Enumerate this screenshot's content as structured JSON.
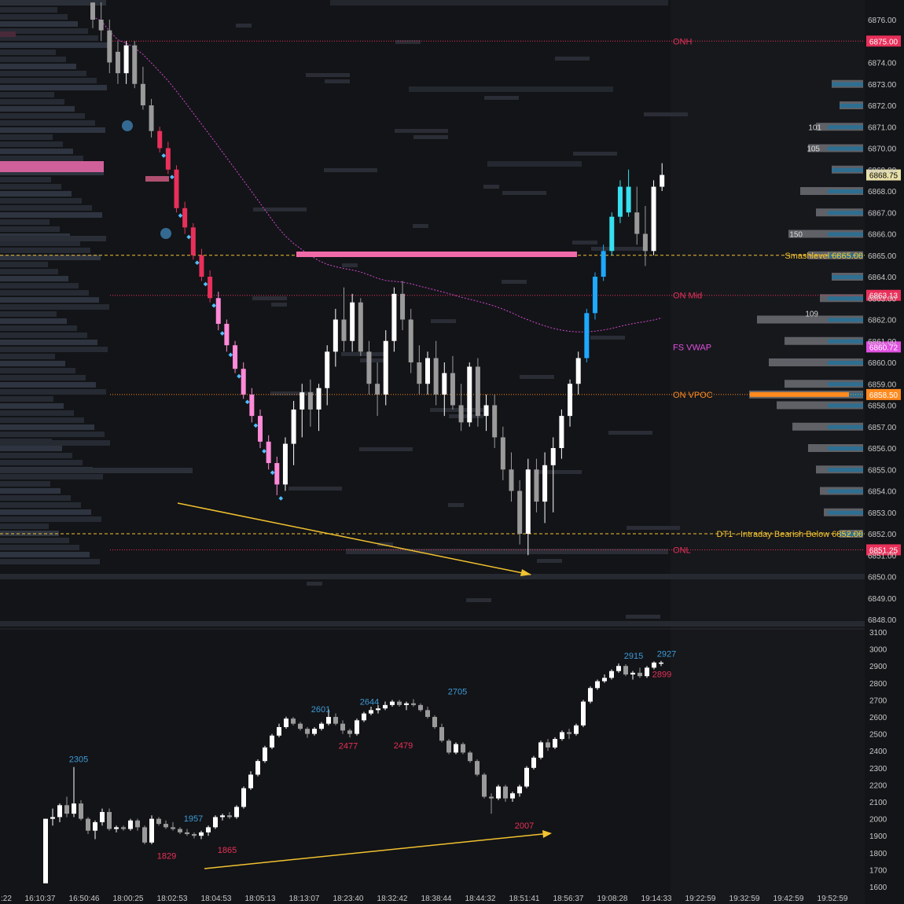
{
  "chart_data": [
    {
      "type": "candlestick",
      "panel": "price",
      "y_ticks": [
        6876,
        6874,
        6873,
        6872,
        6871,
        6870,
        6869,
        6868,
        6867,
        6866,
        6865,
        6864,
        6863,
        6862,
        6861,
        6860,
        6859,
        6858,
        6857,
        6856,
        6855,
        6854,
        6853,
        6852,
        6851,
        6850,
        6849,
        6848
      ],
      "ylim": [
        6847.5,
        6876.8
      ],
      "levels": [
        {
          "name": "ONH",
          "value": 6875.0,
          "label": "ONH",
          "price_tag": "6875.00",
          "color": "#e8305a",
          "style": "dotted"
        },
        {
          "name": "smashlevel",
          "value": 6865.0,
          "label": "Smashlevel  6865.00",
          "price_tag": "",
          "color": "#f2c230",
          "style": "dashed"
        },
        {
          "name": "ON Mid",
          "value": 6863.13,
          "label": "ON Mid",
          "price_tag": "6863.13",
          "color": "#e8305a",
          "style": "dotted"
        },
        {
          "name": "FS VWAP",
          "value": 6860.72,
          "label": "FS VWAP",
          "price_tag": "6860.72",
          "color": "#e050e0",
          "style": "line"
        },
        {
          "name": "ON VPOC",
          "value": 6858.5,
          "label": "ON VPOC",
          "price_tag": "6858.50",
          "color": "#ff8a1e",
          "style": "dotted"
        },
        {
          "name": "DT1",
          "value": 6852.0,
          "label": "DT1 - Intraday Bearish Below  6852.00",
          "price_tag": "",
          "color": "#f2c230",
          "style": "dashed"
        },
        {
          "name": "ONL",
          "value": 6851.25,
          "label": "ONL",
          "price_tag": "6851.25",
          "color": "#e8305a",
          "style": "dotted"
        }
      ],
      "last_price_tag": "6868.75",
      "profile_labels": [
        {
          "text": "101",
          "price": 6871.0
        },
        {
          "text": "105",
          "price": 6870.0
        },
        {
          "text": "150",
          "price": 6866.0
        },
        {
          "text": "109",
          "price": 6862.3
        }
      ],
      "candles": [
        [
          6876.8,
          6876.8,
          6875.6,
          6876.0
        ],
        [
          6876.0,
          6876.8,
          6875.0,
          6875.5
        ],
        [
          6875.5,
          6876.0,
          6873.5,
          6874.0
        ],
        [
          6874.5,
          6875.0,
          6873.0,
          6873.5
        ],
        [
          6873.5,
          6875.0,
          6873.0,
          6874.8
        ],
        [
          6874.8,
          6875.0,
          6872.8,
          6873.0
        ],
        [
          6873.0,
          6873.8,
          6871.8,
          6872.0
        ],
        [
          6872.0,
          6872.3,
          6870.5,
          6870.8
        ],
        [
          6870.8,
          6871.0,
          6869.8,
          6870.0
        ],
        [
          6870.0,
          6870.3,
          6868.8,
          6869.0
        ],
        [
          6869.0,
          6869.2,
          6867.0,
          6867.2
        ],
        [
          6867.2,
          6867.5,
          6866.0,
          6866.3
        ],
        [
          6866.3,
          6866.5,
          6864.8,
          6865.0
        ],
        [
          6865.0,
          6865.3,
          6863.8,
          6864.0
        ],
        [
          6864.0,
          6864.3,
          6862.8,
          6863.0
        ],
        [
          6863.0,
          6863.3,
          6861.5,
          6861.8
        ],
        [
          6861.8,
          6862.0,
          6860.5,
          6860.8
        ],
        [
          6860.8,
          6861.0,
          6859.5,
          6859.7
        ],
        [
          6859.7,
          6860.0,
          6858.3,
          6858.5
        ],
        [
          6858.5,
          6858.8,
          6857.2,
          6857.5
        ],
        [
          6857.5,
          6857.8,
          6856.0,
          6856.3
        ],
        [
          6856.3,
          6856.6,
          6855.0,
          6855.3
        ],
        [
          6855.3,
          6855.6,
          6853.8,
          6854.3
        ],
        [
          6854.3,
          6856.5,
          6854.0,
          6856.2
        ],
        [
          6856.2,
          6858.2,
          6855.2,
          6857.8
        ],
        [
          6857.8,
          6859.0,
          6856.5,
          6858.6
        ],
        [
          6858.6,
          6859.2,
          6857.0,
          6857.8
        ],
        [
          6857.8,
          6859.0,
          6856.8,
          6858.8
        ],
        [
          6858.8,
          6860.8,
          6858.0,
          6860.5
        ],
        [
          6860.5,
          6862.5,
          6859.8,
          6862.0
        ],
        [
          6862.0,
          6863.5,
          6860.5,
          6861.0
        ],
        [
          6861.0,
          6863.2,
          6860.5,
          6862.8
        ],
        [
          6862.8,
          6863.0,
          6860.3,
          6860.5
        ],
        [
          6860.5,
          6861.0,
          6858.5,
          6859.0
        ],
        [
          6859.0,
          6860.0,
          6857.5,
          6858.5
        ],
        [
          6858.5,
          6861.5,
          6858.0,
          6861.0
        ],
        [
          6861.0,
          6863.5,
          6860.5,
          6863.2
        ],
        [
          6863.2,
          6863.8,
          6861.5,
          6862.0
        ],
        [
          6862.0,
          6862.5,
          6859.5,
          6860.0
        ],
        [
          6860.0,
          6860.8,
          6858.5,
          6859.0
        ],
        [
          6859.0,
          6860.5,
          6858.5,
          6860.2
        ],
        [
          6860.2,
          6861.0,
          6858.0,
          6858.5
        ],
        [
          6858.5,
          6860.0,
          6857.5,
          6859.5
        ],
        [
          6859.5,
          6860.3,
          6857.8,
          6858.0
        ],
        [
          6858.0,
          6859.0,
          6856.8,
          6857.2
        ],
        [
          6857.2,
          6860.0,
          6857.0,
          6859.8
        ],
        [
          6859.8,
          6860.2,
          6857.0,
          6857.5
        ],
        [
          6857.5,
          6858.5,
          6856.8,
          6858.0
        ],
        [
          6858.0,
          6858.5,
          6856.0,
          6856.5
        ],
        [
          6856.5,
          6857.0,
          6854.5,
          6855.0
        ],
        [
          6855.0,
          6855.8,
          6853.5,
          6854.0
        ],
        [
          6854.0,
          6854.5,
          6851.5,
          6852.0
        ],
        [
          6852.0,
          6855.5,
          6851.0,
          6855.0
        ],
        [
          6855.0,
          6855.5,
          6853.0,
          6853.5
        ],
        [
          6853.5,
          6855.8,
          6852.5,
          6855.2
        ],
        [
          6855.2,
          6856.5,
          6853.0,
          6856.0
        ],
        [
          6856.0,
          6857.8,
          6855.5,
          6857.5
        ],
        [
          6857.5,
          6859.2,
          6857.0,
          6859.0
        ],
        [
          6859.0,
          6860.5,
          6858.5,
          6860.2
        ],
        [
          6860.2,
          6862.5,
          6860.0,
          6862.3
        ],
        [
          6862.3,
          6864.2,
          6862.0,
          6864.0
        ],
        [
          6864.0,
          6865.5,
          6863.8,
          6865.2
        ],
        [
          6865.2,
          6867.0,
          6865.0,
          6866.8
        ],
        [
          6866.8,
          6868.5,
          6866.5,
          6868.2
        ],
        [
          6868.2,
          6869.0,
          6866.8,
          6867.0
        ],
        [
          6867.0,
          6868.2,
          6865.5,
          6866.0
        ],
        [
          6866.0,
          6867.3,
          6864.5,
          6865.2
        ],
        [
          6865.2,
          6868.5,
          6865.0,
          6868.2
        ],
        [
          6868.2,
          6869.3,
          6868.0,
          6868.75
        ]
      ]
    },
    {
      "type": "candlestick",
      "panel": "cumulative_delta",
      "y_ticks": [
        3100,
        3000,
        2900,
        2800,
        2700,
        2600,
        2500,
        2400,
        2300,
        2200,
        2100,
        2000,
        1900,
        1800,
        1700,
        1600
      ],
      "ylim": [
        1600,
        3100
      ],
      "x_ticks": [
        ":22",
        "16:10:37",
        "16:50:46",
        "18:00:25",
        "18:02:53",
        "18:04:53",
        "18:05:13",
        "18:13:07",
        "18:23:40",
        "18:32:42",
        "18:38:44",
        "18:44:32",
        "18:51:41",
        "18:56:37",
        "19:08:28",
        "19:14:33",
        "19:22:59",
        "19:32:59",
        "19:42:59",
        "19:52:59"
      ],
      "labels": [
        {
          "text": "2305",
          "value": 2305,
          "color": "#3d9ad8"
        },
        {
          "text": "1829",
          "value": 1829,
          "color": "#e8305a"
        },
        {
          "text": "1957",
          "value": 1957,
          "color": "#3d9ad8"
        },
        {
          "text": "1865",
          "value": 1865,
          "color": "#e8305a"
        },
        {
          "text": "2601",
          "value": 2601,
          "color": "#3d9ad8"
        },
        {
          "text": "2477",
          "value": 2477,
          "color": "#e8305a"
        },
        {
          "text": "2644",
          "value": 2644,
          "color": "#3d9ad8"
        },
        {
          "text": "2479",
          "value": 2479,
          "color": "#e8305a"
        },
        {
          "text": "2705",
          "value": 2705,
          "color": "#3d9ad8"
        },
        {
          "text": "2007",
          "value": 2007,
          "color": "#e8305a"
        },
        {
          "text": "2915",
          "value": 2915,
          "color": "#3d9ad8"
        },
        {
          "text": "2927",
          "value": 2927,
          "color": "#3d9ad8"
        },
        {
          "text": "2899",
          "value": 2899,
          "color": "#e8305a"
        }
      ],
      "candles": [
        [
          1620,
          2000,
          1620,
          2000
        ],
        [
          2000,
          2060,
          1960,
          2010
        ],
        [
          2010,
          2090,
          1980,
          2080
        ],
        [
          2080,
          2130,
          2010,
          2030
        ],
        [
          2030,
          2305,
          2010,
          2090
        ],
        [
          2090,
          2110,
          1990,
          2000
        ],
        [
          2000,
          2010,
          1910,
          1930
        ],
        [
          1930,
          1990,
          1880,
          1980
        ],
        [
          1980,
          2060,
          1960,
          2040
        ],
        [
          2040,
          2060,
          1930,
          1940
        ],
        [
          1940,
          1960,
          1920,
          1950
        ],
        [
          1950,
          1960,
          1930,
          1940
        ],
        [
          1940,
          2000,
          1930,
          1990
        ],
        [
          1990,
          2000,
          1930,
          1950
        ],
        [
          1950,
          1960,
          1850,
          1860
        ],
        [
          1860,
          2020,
          1850,
          2000
        ],
        [
          2000,
          2010,
          1960,
          1970
        ],
        [
          1970,
          1990,
          1940,
          1950
        ],
        [
          1950,
          1980,
          1930,
          1940
        ],
        [
          1940,
          1950,
          1910,
          1920
        ],
        [
          1920,
          1940,
          1900,
          1910
        ],
        [
          1910,
          1920,
          1885,
          1900
        ],
        [
          1900,
          1930,
          1880,
          1920
        ],
        [
          1920,
          1960,
          1900,
          1950
        ],
        [
          1950,
          2020,
          1940,
          2010
        ],
        [
          2010,
          2030,
          1990,
          2020
        ],
        [
          2020,
          2040,
          2000,
          2010
        ],
        [
          2010,
          2080,
          2000,
          2070
        ],
        [
          2070,
          2190,
          2060,
          2180
        ],
        [
          2180,
          2280,
          2170,
          2260
        ],
        [
          2260,
          2350,
          2250,
          2340
        ],
        [
          2340,
          2430,
          2330,
          2420
        ],
        [
          2420,
          2500,
          2410,
          2490
        ],
        [
          2490,
          2560,
          2480,
          2540
        ],
        [
          2540,
          2601,
          2530,
          2590
        ],
        [
          2590,
          2600,
          2550,
          2560
        ],
        [
          2560,
          2570,
          2520,
          2530
        ],
        [
          2530,
          2540,
          2477,
          2500
        ],
        [
          2500,
          2540,
          2490,
          2530
        ],
        [
          2530,
          2570,
          2520,
          2560
        ],
        [
          2560,
          2644,
          2550,
          2600
        ],
        [
          2600,
          2620,
          2550,
          2560
        ],
        [
          2560,
          2580,
          2500,
          2520
        ],
        [
          2520,
          2530,
          2479,
          2500
        ],
        [
          2500,
          2590,
          2490,
          2580
        ],
        [
          2580,
          2630,
          2570,
          2620
        ],
        [
          2620,
          2660,
          2610,
          2640
        ],
        [
          2640,
          2670,
          2620,
          2650
        ],
        [
          2650,
          2690,
          2640,
          2670
        ],
        [
          2670,
          2700,
          2660,
          2690
        ],
        [
          2690,
          2700,
          2660,
          2670
        ],
        [
          2670,
          2690,
          2640,
          2680
        ],
        [
          2680,
          2705,
          2660,
          2670
        ],
        [
          2670,
          2680,
          2630,
          2640
        ],
        [
          2640,
          2660,
          2590,
          2600
        ],
        [
          2600,
          2610,
          2530,
          2540
        ],
        [
          2540,
          2560,
          2450,
          2460
        ],
        [
          2460,
          2470,
          2380,
          2390
        ],
        [
          2390,
          2450,
          2380,
          2440
        ],
        [
          2440,
          2450,
          2380,
          2390
        ],
        [
          2390,
          2400,
          2330,
          2340
        ],
        [
          2340,
          2350,
          2250,
          2260
        ],
        [
          2260,
          2270,
          2120,
          2130
        ],
        [
          2130,
          2150,
          2030,
          2120
        ],
        [
          2120,
          2200,
          2110,
          2190
        ],
        [
          2190,
          2200,
          2100,
          2120
        ],
        [
          2120,
          2160,
          2100,
          2150
        ],
        [
          2150,
          2200,
          2130,
          2190
        ],
        [
          2190,
          2310,
          2180,
          2300
        ],
        [
          2300,
          2370,
          2290,
          2360
        ],
        [
          2360,
          2460,
          2350,
          2450
        ],
        [
          2450,
          2470,
          2400,
          2420
        ],
        [
          2420,
          2480,
          2410,
          2470
        ],
        [
          2470,
          2520,
          2460,
          2510
        ],
        [
          2510,
          2530,
          2470,
          2500
        ],
        [
          2500,
          2560,
          2490,
          2550
        ],
        [
          2550,
          2700,
          2540,
          2690
        ],
        [
          2690,
          2780,
          2680,
          2770
        ],
        [
          2770,
          2820,
          2760,
          2810
        ],
        [
          2810,
          2850,
          2800,
          2830
        ],
        [
          2830,
          2880,
          2820,
          2870
        ],
        [
          2870,
          2915,
          2860,
          2900
        ],
        [
          2900,
          2910,
          2840,
          2850
        ],
        [
          2850,
          2870,
          2820,
          2860
        ],
        [
          2860,
          2890,
          2830,
          2840
        ],
        [
          2840,
          2900,
          2830,
          2890
        ],
        [
          2890,
          2927,
          2880,
          2920
        ],
        [
          2920,
          2930,
          2899,
          2920
        ]
      ]
    }
  ]
}
